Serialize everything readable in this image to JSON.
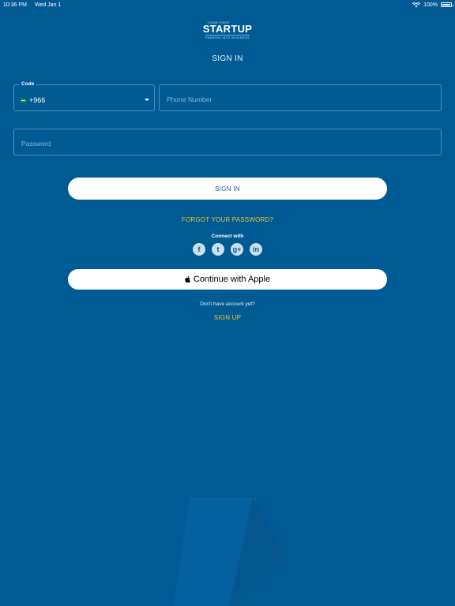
{
  "status_bar": {
    "time": "10:36 PM",
    "date": "Wed Jan 1",
    "battery": "100%"
  },
  "logo": {
    "top": "YOUR FIRST",
    "main": "STARTUP",
    "tagline": "PASSION INTO BUSINESS"
  },
  "page_title": "SIGN IN",
  "form": {
    "code_label": "Code",
    "code_value": "+966",
    "phone_placeholder": "Phone Number",
    "password_placeholder": "Password"
  },
  "actions": {
    "sign_in": "SIGN IN",
    "forgot_password": "FORGOT YOUR PASSWORD?",
    "connect_with": "Connect with",
    "apple": "Continue with Apple",
    "no_account": "Don't have account yet?",
    "sign_up": "SIGN UP"
  },
  "social": [
    {
      "icon": "facebook-icon",
      "glyph": "f"
    },
    {
      "icon": "twitter-icon",
      "glyph": "t"
    },
    {
      "icon": "google-plus-icon",
      "glyph": "g+"
    },
    {
      "icon": "linkedin-icon",
      "glyph": "in"
    }
  ],
  "colors": {
    "background": "#005b94",
    "accent_link": "#f2c12e",
    "button_text": "#1a5c88"
  }
}
